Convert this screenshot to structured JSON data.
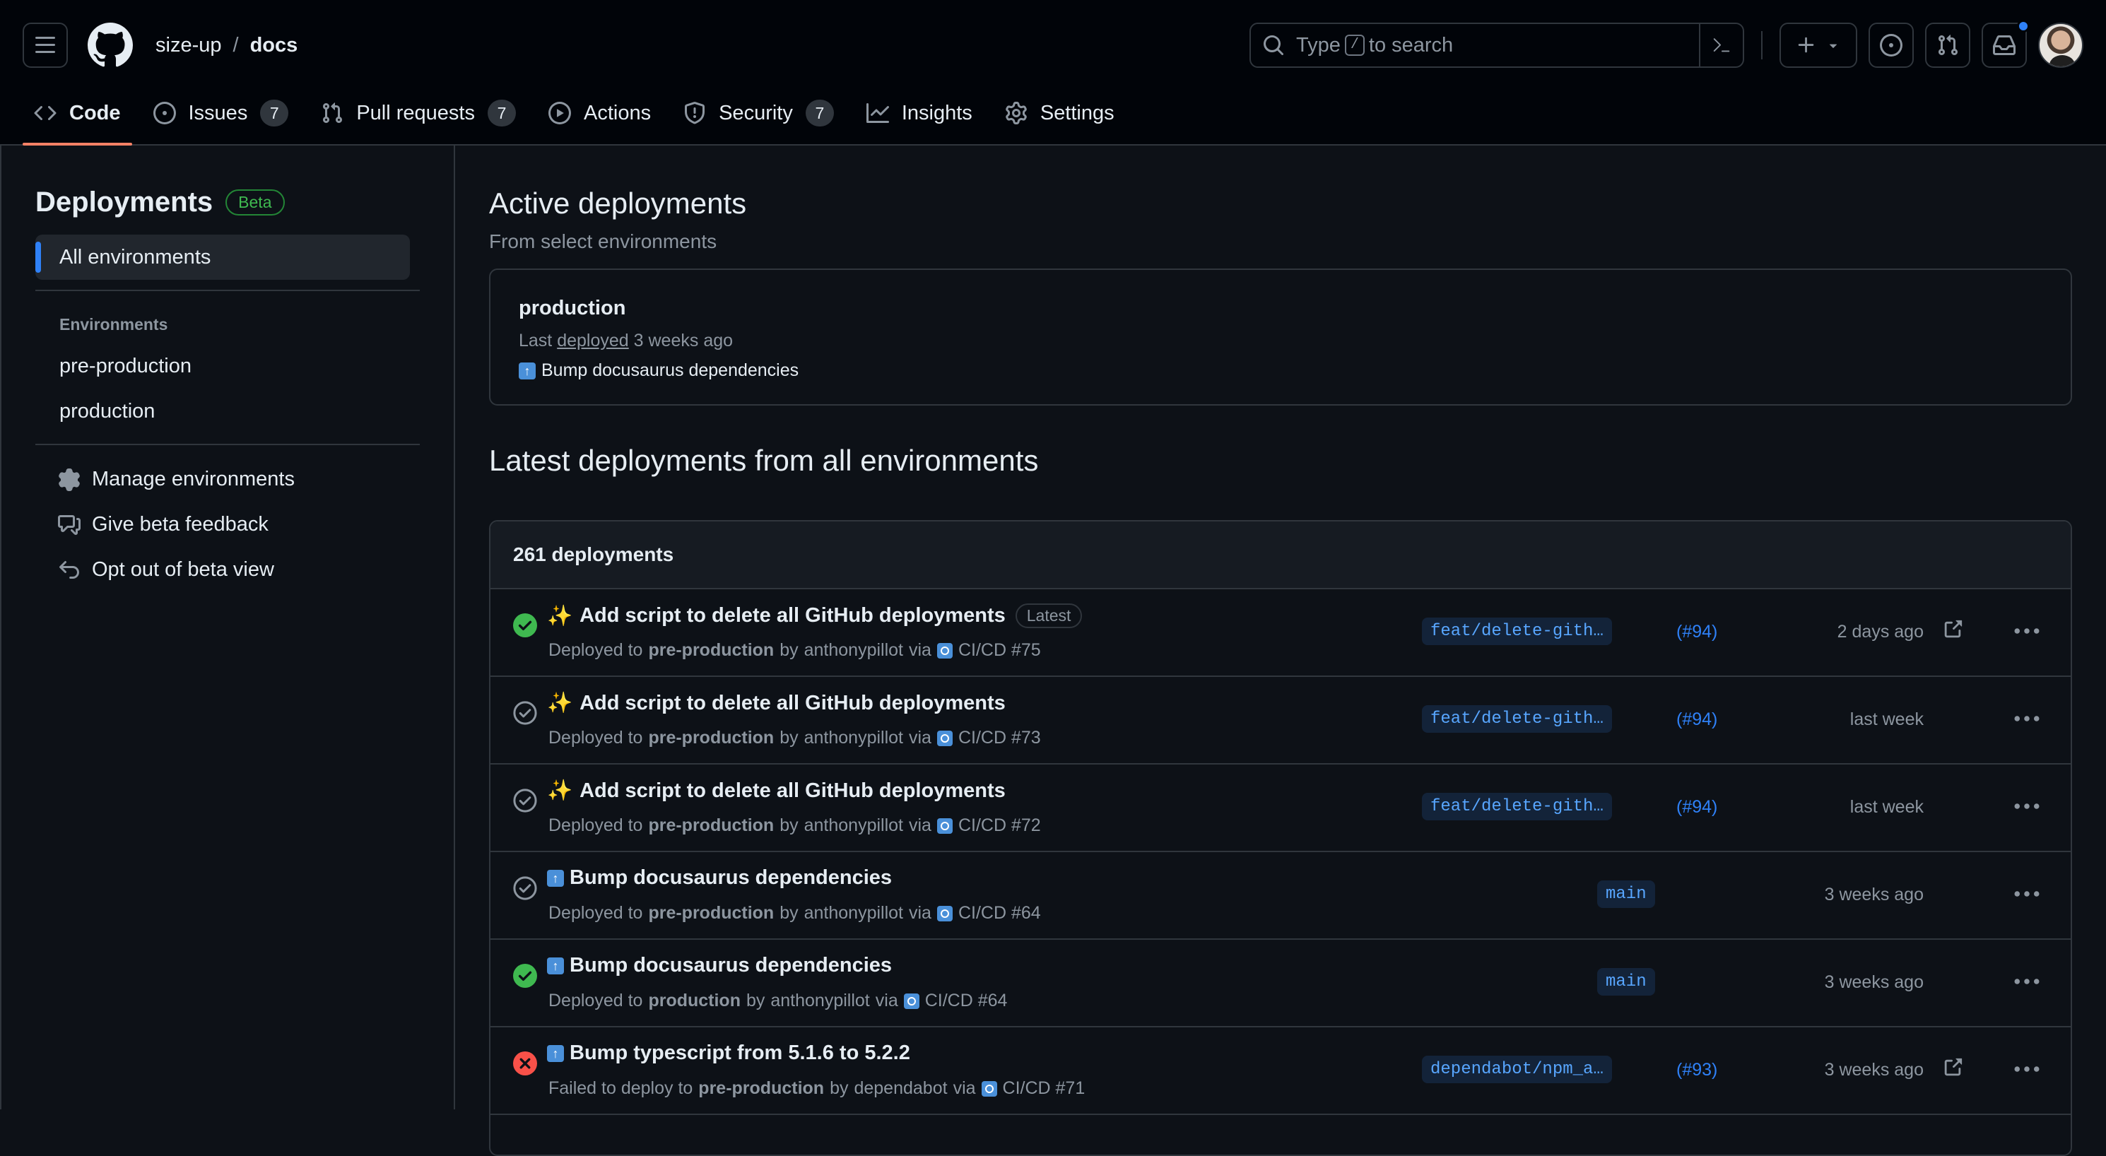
{
  "header": {
    "owner": "size-up",
    "separator": "/",
    "repo": "docs",
    "search_prefix": "Type",
    "search_key": "/",
    "search_suffix": "to search"
  },
  "tabs": [
    {
      "label": "Code",
      "icon": "code-icon"
    },
    {
      "label": "Issues",
      "icon": "issue-opened-icon",
      "count": "7"
    },
    {
      "label": "Pull requests",
      "icon": "git-pull-request-icon",
      "count": "7"
    },
    {
      "label": "Actions",
      "icon": "play-icon"
    },
    {
      "label": "Security",
      "icon": "shield-icon",
      "count": "7"
    },
    {
      "label": "Insights",
      "icon": "graph-icon"
    },
    {
      "label": "Settings",
      "icon": "gear-icon"
    }
  ],
  "sidebar": {
    "title": "Deployments",
    "badge": "Beta",
    "all_environments": "All environments",
    "environments_heading": "Environments",
    "environments": [
      "pre-production",
      "production"
    ],
    "actions": [
      {
        "label": "Manage environments",
        "icon": "gear-icon"
      },
      {
        "label": "Give beta feedback",
        "icon": "comment-discussion-icon"
      },
      {
        "label": "Opt out of beta view",
        "icon": "undo-icon"
      }
    ]
  },
  "main": {
    "active_title": "Active deployments",
    "active_subtitle": "From select environments",
    "active_card": {
      "environment": "production",
      "last_prefix": "Last",
      "last_link": "deployed",
      "last_suffix": "3 weeks ago",
      "commit": "Bump docusaurus dependencies"
    },
    "latest_title": "Latest deployments from all environments",
    "count_label": "261 deployments",
    "deployments": [
      {
        "status": "success",
        "emoji": "sparkles",
        "title": "Add script to delete all GitHub deployments",
        "badge": "Latest",
        "prefix": "Deployed to",
        "env": "pre-production",
        "by": "by",
        "user": "anthonypillot",
        "via": "via",
        "workflow": "CI/CD #75",
        "branch": "feat/delete-gith…",
        "pr": "(#94)",
        "time": "2 days ago",
        "external": true
      },
      {
        "status": "inactive",
        "emoji": "sparkles",
        "title": "Add script to delete all GitHub deployments",
        "badge": "",
        "prefix": "Deployed to",
        "env": "pre-production",
        "by": "by",
        "user": "anthonypillot",
        "via": "via",
        "workflow": "CI/CD #73",
        "branch": "feat/delete-gith…",
        "pr": "(#94)",
        "time": "last week",
        "external": false
      },
      {
        "status": "inactive",
        "emoji": "sparkles",
        "title": "Add script to delete all GitHub deployments",
        "badge": "",
        "prefix": "Deployed to",
        "env": "pre-production",
        "by": "by",
        "user": "anthonypillot",
        "via": "via",
        "workflow": "CI/CD #72",
        "branch": "feat/delete-gith…",
        "pr": "(#94)",
        "time": "last week",
        "external": false
      },
      {
        "status": "inactive",
        "emoji": "arrow-up",
        "title": "Bump docusaurus dependencies",
        "badge": "",
        "prefix": "Deployed to",
        "env": "pre-production",
        "by": "by",
        "user": "anthonypillot",
        "via": "via",
        "workflow": "CI/CD #64",
        "branch": "main",
        "pr": "",
        "time": "3 weeks ago",
        "external": false
      },
      {
        "status": "success",
        "emoji": "arrow-up",
        "title": "Bump docusaurus dependencies",
        "badge": "",
        "prefix": "Deployed to",
        "env": "production",
        "by": "by",
        "user": "anthonypillot",
        "via": "via",
        "workflow": "CI/CD #64",
        "branch": "main",
        "pr": "",
        "time": "3 weeks ago",
        "external": false
      },
      {
        "status": "failure",
        "emoji": "arrow-up",
        "title": "Bump typescript from 5.1.6 to 5.2.2",
        "badge": "",
        "prefix": "Failed to deploy to",
        "env": "pre-production",
        "by": "by",
        "user": "dependabot",
        "via": "via",
        "workflow": "CI/CD #71",
        "branch": "dependabot/npm_a…",
        "pr": "(#93)",
        "time": "3 weeks ago",
        "external": true
      }
    ]
  },
  "colors": {
    "accent": "#2f81f7",
    "success": "#3fb950",
    "failure": "#f85149",
    "tab_underline": "#f78166"
  }
}
